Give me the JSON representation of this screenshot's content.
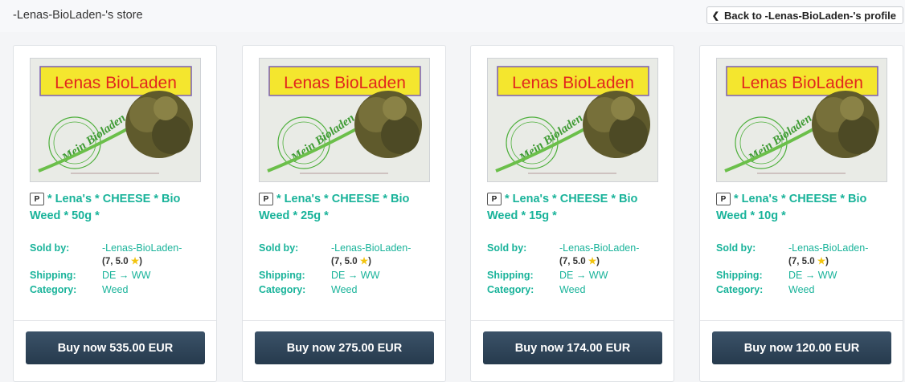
{
  "header": {
    "store_title": "-Lenas-BioLaden-'s store",
    "back_label": "Back to -Lenas-BioLaden-'s profile"
  },
  "labels": {
    "sold_by": "Sold by:",
    "shipping": "Shipping:",
    "category": "Category:"
  },
  "listings": [
    {
      "badge": "P",
      "title": "* Lena's * CHEESE * Bio Weed * 50g *",
      "seller": "-Lenas-BioLaden-",
      "rating_prefix": "(7, 5.0 ",
      "rating_suffix": ")",
      "shipping": "DE → WW",
      "category": "Weed",
      "buy_label": "Buy now 535.00 EUR",
      "image": {
        "banner": "Lenas BioLaden",
        "stamp": "Mein Bioladen"
      }
    },
    {
      "badge": "P",
      "title": "* Lena's * CHEESE * Bio Weed * 25g *",
      "seller": "-Lenas-BioLaden-",
      "rating_prefix": "(7, 5.0 ",
      "rating_suffix": ")",
      "shipping": "DE → WW",
      "category": "Weed",
      "buy_label": "Buy now 275.00 EUR",
      "image": {
        "banner": "Lenas BioLaden",
        "stamp": "Mein Bioladen"
      }
    },
    {
      "badge": "P",
      "title": "* Lena's * CHEESE * Bio Weed * 15g *",
      "seller": "-Lenas-BioLaden-",
      "rating_prefix": "(7, 5.0 ",
      "rating_suffix": ")",
      "shipping": "DE → WW",
      "category": "Weed",
      "buy_label": "Buy now 174.00 EUR",
      "image": {
        "banner": "Lenas BioLaden",
        "stamp": "Mein Bioladen"
      }
    },
    {
      "badge": "P",
      "title": "* Lena's * CHEESE * Bio Weed * 10g *",
      "seller": "-Lenas-BioLaden-",
      "rating_prefix": "(7, 5.0 ",
      "rating_suffix": ")",
      "shipping": "DE → WW",
      "category": "Weed",
      "buy_label": "Buy now 120.00 EUR",
      "image": {
        "banner": "Lenas BioLaden",
        "stamp": "Mein Bioladen"
      }
    }
  ],
  "colors": {
    "accent": "#19b39a",
    "button": "#2e4459",
    "star": "#f2c40f"
  }
}
